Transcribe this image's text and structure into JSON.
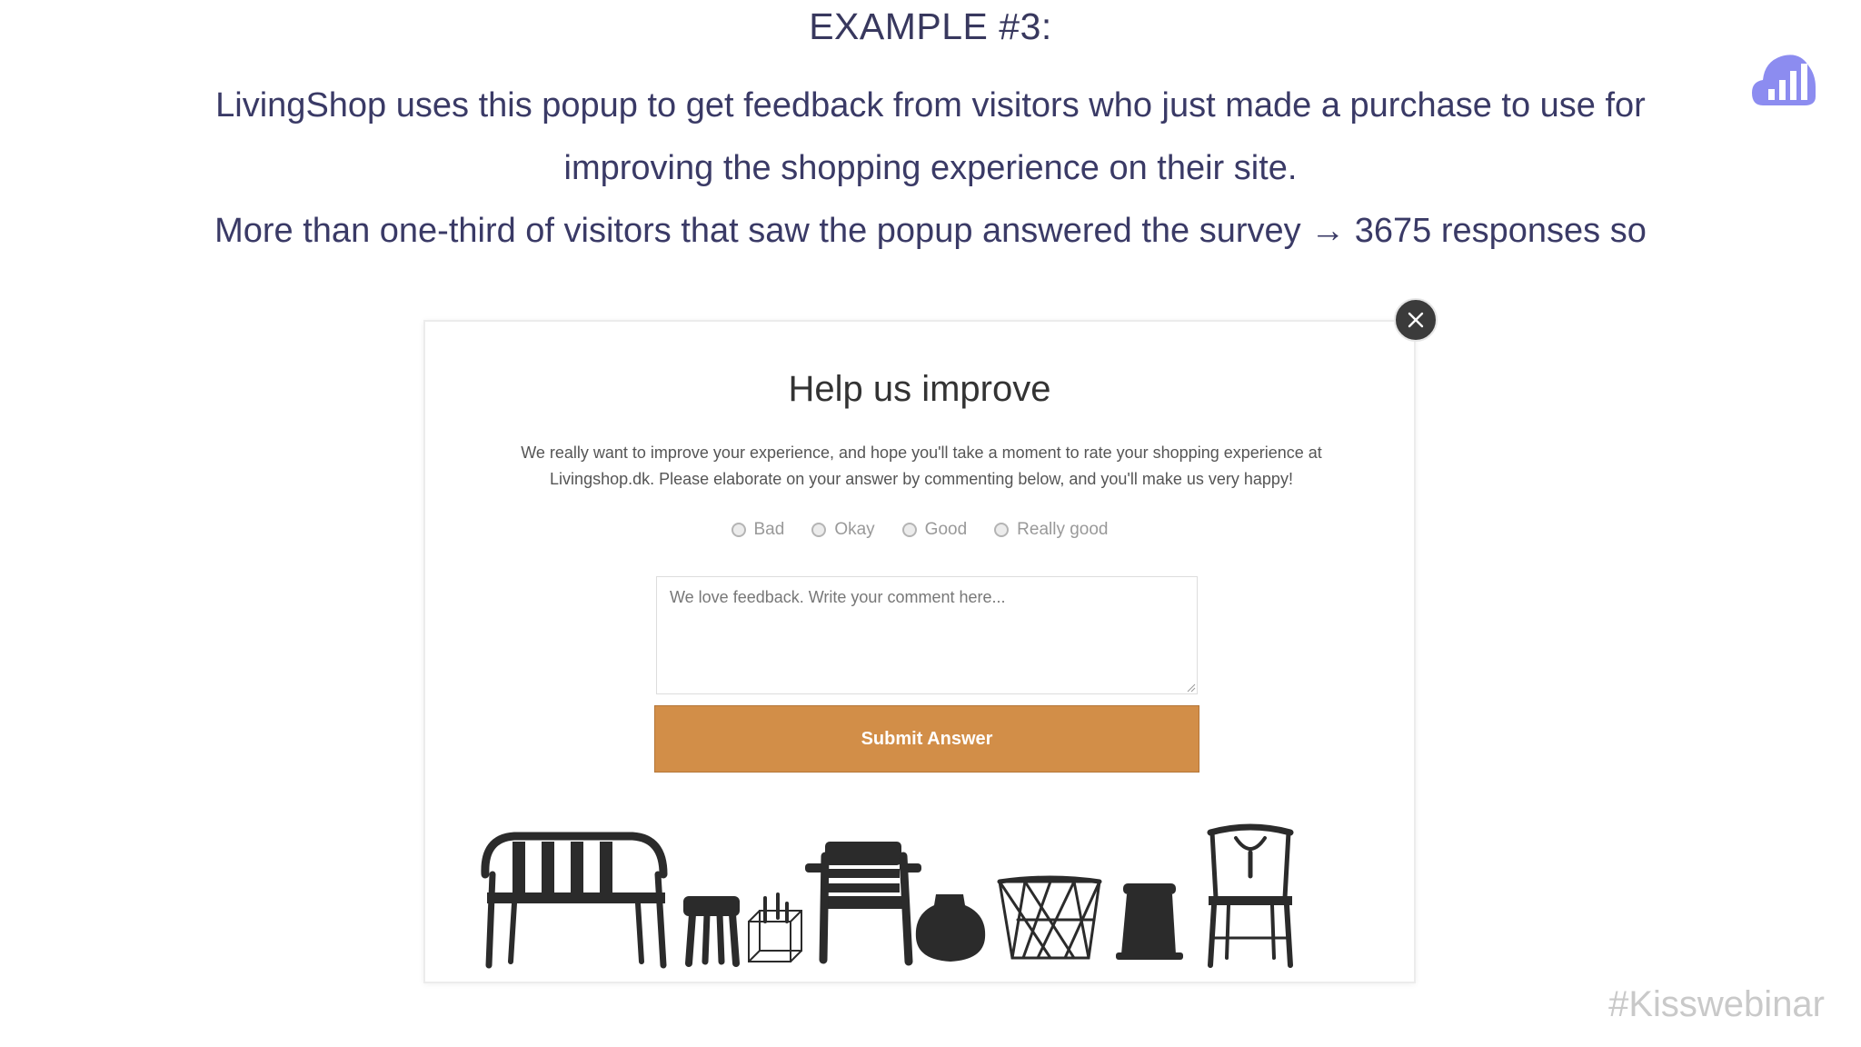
{
  "slide": {
    "title": "EXAMPLE #3:",
    "paragraph_line1": "LivingShop uses this popup to get feedback from visitors who just made a purchase to use for",
    "paragraph_line2": "improving the shopping experience on their site.",
    "paragraph_line3": "More than one-third of visitors that saw the popup answered the survey → 3675 responses so",
    "hashtag": "#Kisswebinar",
    "logo_icon": "bar-chart-cloud-icon"
  },
  "popup": {
    "heading": "Help us improve",
    "description_line1": "We really want to improve your experience, and hope you'll take a moment to rate your shopping experience at",
    "description_line2": "Livingshop.dk. Please elaborate on your answer by commenting below, and you'll make us very happy!",
    "rating_options": [
      "Bad",
      "Okay",
      "Good",
      "Really good"
    ],
    "comment_placeholder": "We love feedback. Write your comment here...",
    "submit_label": "Submit Answer",
    "close_icon": "close-icon"
  },
  "colors": {
    "text_navy": "#3a3a66",
    "logo_purple": "#8c8cf0",
    "submit_orange": "#d28e48",
    "close_dark": "#3b3b3b",
    "furniture": "#2b2b2b"
  }
}
